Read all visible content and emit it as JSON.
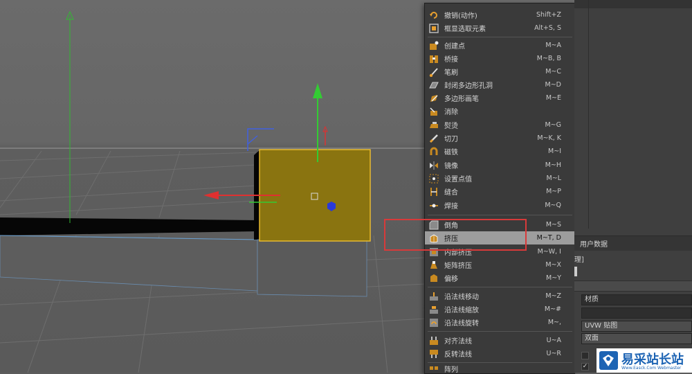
{
  "menu": {
    "items": [
      {
        "label": "撤销(动作)",
        "shortcut": "Shift+Z",
        "icon": "undo-icon"
      },
      {
        "label": "框显选取元素",
        "shortcut": "Alt+S, S",
        "icon": "frame-selection-icon"
      },
      {
        "label": "创建点",
        "shortcut": "M~A",
        "icon": "create-point-icon"
      },
      {
        "label": "桥接",
        "shortcut": "M~B, B",
        "icon": "bridge-icon"
      },
      {
        "label": "笔刷",
        "shortcut": "M~C",
        "icon": "brush-icon"
      },
      {
        "label": "封闭多边形孔洞",
        "shortcut": "M~D",
        "icon": "close-polygon-hole-icon"
      },
      {
        "label": "多边形画笔",
        "shortcut": "M~E",
        "icon": "polygon-pen-icon"
      },
      {
        "label": "消除",
        "shortcut": "",
        "icon": "dissolve-icon"
      },
      {
        "label": "熨烫",
        "shortcut": "M~G",
        "icon": "iron-icon"
      },
      {
        "label": "切刀",
        "shortcut": "M~K, K",
        "icon": "knife-icon"
      },
      {
        "label": "磁铁",
        "shortcut": "M~I",
        "icon": "magnet-icon"
      },
      {
        "label": "镜像",
        "shortcut": "M~H",
        "icon": "mirror-icon"
      },
      {
        "label": "设置点值",
        "shortcut": "M~L",
        "icon": "set-point-value-icon"
      },
      {
        "label": "缝合",
        "shortcut": "M~P",
        "icon": "stitch-icon"
      },
      {
        "label": "焊接",
        "shortcut": "M~Q",
        "icon": "weld-icon"
      },
      {
        "label": "倒角",
        "shortcut": "M~S",
        "icon": "bevel-icon"
      },
      {
        "label": "挤压",
        "shortcut": "M~T, D",
        "icon": "extrude-icon",
        "highlighted": true
      },
      {
        "label": "内部挤压",
        "shortcut": "M~W, I",
        "icon": "extrude-inner-icon"
      },
      {
        "label": "矩阵挤压",
        "shortcut": "M~X",
        "icon": "matrix-extrude-icon"
      },
      {
        "label": "偏移",
        "shortcut": "M~Y",
        "icon": "offset-icon"
      },
      {
        "label": "沿法线移动",
        "shortcut": "M~Z",
        "icon": "normal-move-icon"
      },
      {
        "label": "沿法线缩放",
        "shortcut": "M~#",
        "icon": "normal-scale-icon"
      },
      {
        "label": "沿法线旋转",
        "shortcut": "M~,",
        "icon": "normal-rotate-icon"
      },
      {
        "label": "对齐法线",
        "shortcut": "U~A",
        "icon": "align-normals-icon"
      },
      {
        "label": "反转法线",
        "shortcut": "U~R",
        "icon": "reverse-normals-icon"
      },
      {
        "label": "阵列",
        "shortcut": "",
        "icon": "array-icon"
      }
    ]
  },
  "panel": {
    "tab_user_data": "用户数据",
    "fragment_text": "理]",
    "field_material": "材质",
    "field_uvw": "UVW 贴图",
    "field_double": "双面",
    "check_mark": "✓"
  },
  "watermark": {
    "title": "易采站长站",
    "subtitle": "Www.Easck.Com  Webmaster"
  },
  "colors": {
    "menu_bg": "#3a3a3a",
    "menu_highlight": "#9d9d9d",
    "cube_face": "#8a7410",
    "cube_edge": "#f0c030",
    "axis_y": "#33cc33",
    "axis_x": "#e03030",
    "axis_z": "#2a3ad8",
    "highlight_frame": "#d83a3a"
  }
}
